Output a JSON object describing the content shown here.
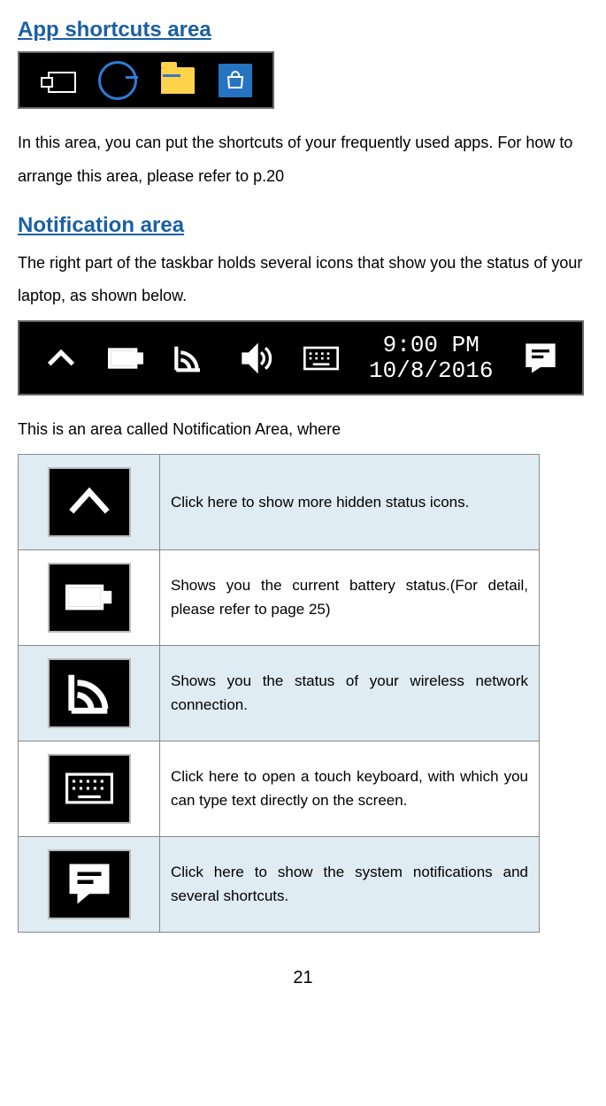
{
  "sections": {
    "app_shortcuts": {
      "heading": "App shortcuts area",
      "description": "In this area, you can put the shortcuts of your frequently used apps. For how to arrange this area, please refer to p.20"
    },
    "notification": {
      "heading": "Notification area",
      "intro": "The right part of the taskbar holds several icons that show you the status of your laptop, as shown below.",
      "caption": "This is an area called Notification Area, where",
      "clock_time": "9:00 PM",
      "clock_date": "10/8/2016"
    }
  },
  "table_rows": [
    {
      "desc": "Click here to show more hidden status icons."
    },
    {
      "desc": "Shows you the current battery status.(For detail, please refer to page 25)"
    },
    {
      "desc": "Shows you the status of your wireless network connection."
    },
    {
      "desc": "Click here to open a touch keyboard, with which you can type text directly on the screen."
    },
    {
      "desc": "Click here to show the system notifications and several shortcuts."
    }
  ],
  "page_number": "21"
}
